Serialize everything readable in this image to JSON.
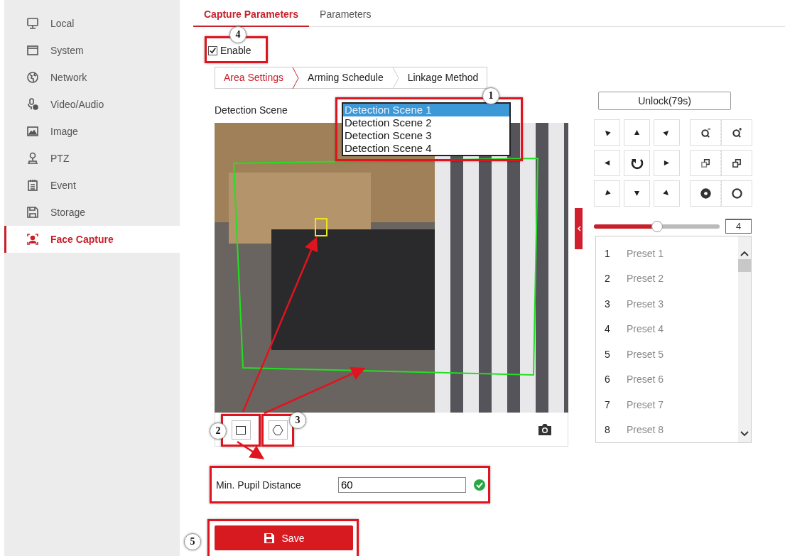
{
  "sidebar": {
    "items": [
      {
        "label": "Local",
        "kind": "monitor",
        "selected": false
      },
      {
        "label": "System",
        "kind": "window",
        "selected": false
      },
      {
        "label": "Network",
        "kind": "globe",
        "selected": false
      },
      {
        "label": "Video/Audio",
        "kind": "video",
        "selected": false
      },
      {
        "label": "Image",
        "kind": "image",
        "selected": false
      },
      {
        "label": "PTZ",
        "kind": "ptz",
        "selected": false
      },
      {
        "label": "Event",
        "kind": "event",
        "selected": false
      },
      {
        "label": "Storage",
        "kind": "storage",
        "selected": false
      },
      {
        "label": "Face Capture",
        "kind": "face",
        "selected": true
      }
    ]
  },
  "tabs": [
    {
      "label": "Capture Parameters",
      "selected": true
    },
    {
      "label": "Parameters",
      "selected": false
    }
  ],
  "enable": {
    "label": "Enable",
    "checked": true,
    "callout": "4"
  },
  "sub_tabs": [
    {
      "label": "Area Settings",
      "selected": true
    },
    {
      "label": "Arming Schedule",
      "selected": false
    },
    {
      "label": "Linkage Method",
      "selected": false
    }
  ],
  "detection_scene": {
    "label": "Detection Scene",
    "callout": "1",
    "options": [
      {
        "label": "Detection Scene 1",
        "selected": true
      },
      {
        "label": "Detection Scene 2",
        "selected": false
      },
      {
        "label": "Detection Scene 3",
        "selected": false
      },
      {
        "label": "Detection Scene 4",
        "selected": false
      }
    ]
  },
  "video": {
    "tools": [
      {
        "kind": "rectangle",
        "callout": "2"
      },
      {
        "kind": "polygon",
        "callout": "3"
      }
    ]
  },
  "ptz": {
    "unlock": "Unlock(79s)",
    "buttons": [
      {
        "kind": "up-left"
      },
      {
        "kind": "up"
      },
      {
        "kind": "up-right"
      },
      {
        "kind": "left"
      },
      {
        "kind": "auto"
      },
      {
        "kind": "right"
      },
      {
        "kind": "down-left"
      },
      {
        "kind": "down"
      },
      {
        "kind": "down-right"
      }
    ],
    "lens": [
      {
        "kind": "zoom-out"
      },
      {
        "kind": "zoom-in"
      },
      {
        "kind": "focus-near"
      },
      {
        "kind": "focus-far"
      },
      {
        "kind": "iris-close"
      },
      {
        "kind": "iris-open"
      }
    ],
    "speed": {
      "level": 0.5,
      "value": "4"
    },
    "presets": [
      {
        "number": "1",
        "name": "Preset 1"
      },
      {
        "number": "2",
        "name": "Preset 2"
      },
      {
        "number": "3",
        "name": "Preset 3"
      },
      {
        "number": "4",
        "name": "Preset 4"
      },
      {
        "number": "5",
        "name": "Preset 5"
      },
      {
        "number": "6",
        "name": "Preset 6"
      },
      {
        "number": "7",
        "name": "Preset 7"
      },
      {
        "number": "8",
        "name": "Preset 8"
      }
    ]
  },
  "pupil": {
    "label": "Min. Pupil Distance",
    "value": "60",
    "valid": true
  },
  "save": {
    "label": "Save",
    "callout": "5"
  }
}
